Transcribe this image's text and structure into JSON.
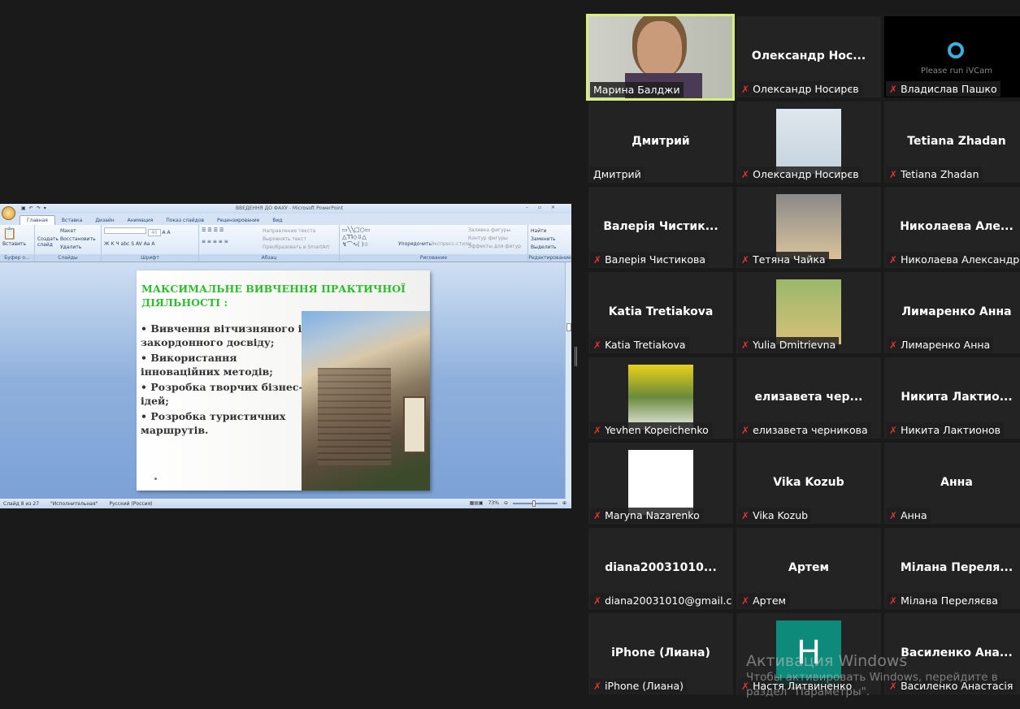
{
  "powerpoint": {
    "title": "ВВЕДЕННЯ ДО ФАХУ - Microsoft PowerPoint",
    "tabs": [
      "Главная",
      "Вставка",
      "Дизайн",
      "Анимация",
      "Показ слайдов",
      "Рецензирование",
      "Вид"
    ],
    "ribbon": {
      "clipboard": {
        "paste": "Вставить",
        "label": "Буфер о..."
      },
      "slides": {
        "new_slide": "Создать слайд",
        "layout": "Макет",
        "reset": "Восстановить",
        "delete": "Удалить",
        "label": "Слайды"
      },
      "font": {
        "size": "40",
        "label": "Шрифт"
      },
      "paragraph": {
        "text_direction": "Направление текста",
        "align_text": "Выровнять текст",
        "smartart": "Преобразовать в SmartArt",
        "label": "Абзац"
      },
      "drawing": {
        "arrange": "Упорядочить",
        "quick_styles": "Экспресс-стили",
        "fill": "Заливка фигуры",
        "outline": "Контур фигуры",
        "effects": "Эффекты для фигур",
        "label": "Рисование"
      },
      "editing": {
        "find": "Найти",
        "replace": "Заменить",
        "select": "Выделить",
        "label": "Редактирование"
      }
    },
    "slide": {
      "title": "МАКСИМАЛЬНЕ ВИВЧЕННЯ ПРАКТИЧНОЇ ДІЯЛЬНОСТІ :",
      "bullets": [
        "•  Вивчення вітчизняного і закордонного досвіду;",
        "•  Використання інноваційних методів;",
        "•  Розробка творчих бізнес-ідей;",
        "•  Розробка туристичних маршрутів."
      ]
    },
    "status": {
      "slide": "Слайд 8 из 27",
      "theme": "\"Исполнительная\"",
      "language": "Русский (Россия)",
      "zoom": "73%"
    }
  },
  "participants": [
    {
      "big": "",
      "name": "Марина Балджи",
      "muted": false,
      "video": "person",
      "active": true
    },
    {
      "big": "Олександр  Нос...",
      "name": "Олександр Носирєв",
      "muted": true
    },
    {
      "big": "",
      "name": "Владислав Пашко",
      "muted": true,
      "video": "ivcam",
      "ivcam_text": "Please run iVCam"
    },
    {
      "big": "Дмитрий",
      "name": "Дмитрий",
      "muted": false
    },
    {
      "big": "",
      "name": "Олександр Носирєв",
      "muted": true,
      "video": "photo"
    },
    {
      "big": "Tetiana Zhadan",
      "name": "Tetiana Zhadan",
      "muted": true
    },
    {
      "big": "Валерія  Чистик...",
      "name": "Валерія Чистикова",
      "muted": true
    },
    {
      "big": "",
      "name": "Тетяна Чайка",
      "muted": true,
      "video": "photo"
    },
    {
      "big": "Николаева  Але...",
      "name": "Николаева Александра",
      "muted": true
    },
    {
      "big": "Katia Tretiakova",
      "name": "Katia Tretiakova",
      "muted": true
    },
    {
      "big": "",
      "name": "Yulia Dmitrievna",
      "muted": true,
      "video": "photo"
    },
    {
      "big": "Лимаренко Анна",
      "name": "Лимаренко Анна",
      "muted": true
    },
    {
      "big": "",
      "name": "Yevhen Kopeichenko",
      "muted": true,
      "video": "photo"
    },
    {
      "big": "елизавета   чер...",
      "name": "елизавета  черникова",
      "muted": true
    },
    {
      "big": "Никита  Лактио...",
      "name": "Никита Лактионов",
      "muted": true
    },
    {
      "big": "",
      "name": "Maryna Nazarenko",
      "muted": true,
      "video": "photo"
    },
    {
      "big": "Vika Kozub",
      "name": "Vika Kozub",
      "muted": true
    },
    {
      "big": "Анна",
      "name": "Анна",
      "muted": true
    },
    {
      "big": "diana20031010...",
      "name": "diana20031010@gmail.c...",
      "muted": true
    },
    {
      "big": "Артем",
      "name": "Артем",
      "muted": true
    },
    {
      "big": "Мілана  Переля...",
      "name": "Мілана Переляєва",
      "muted": true
    },
    {
      "big": "iPhone (Лиана)",
      "name": "iPhone (Лиана)",
      "muted": true
    },
    {
      "big": "",
      "name": "Настя Литвиненко",
      "muted": true,
      "video": "letter",
      "letter": "Н"
    },
    {
      "big": "Василенко  Ана...",
      "name": "Василенко Анастасія",
      "muted": true
    }
  ],
  "windows_activation": {
    "title": "Активация Windows",
    "text1": "Чтобы активировать Windows, перейдите в",
    "text2": "раздел \"Параметры\"."
  },
  "colors": {
    "active_border": "#d7f07a",
    "muted": "#e0332f",
    "slide_title": "#2bbf2b",
    "letter_avatar": "#0e8a7a"
  }
}
